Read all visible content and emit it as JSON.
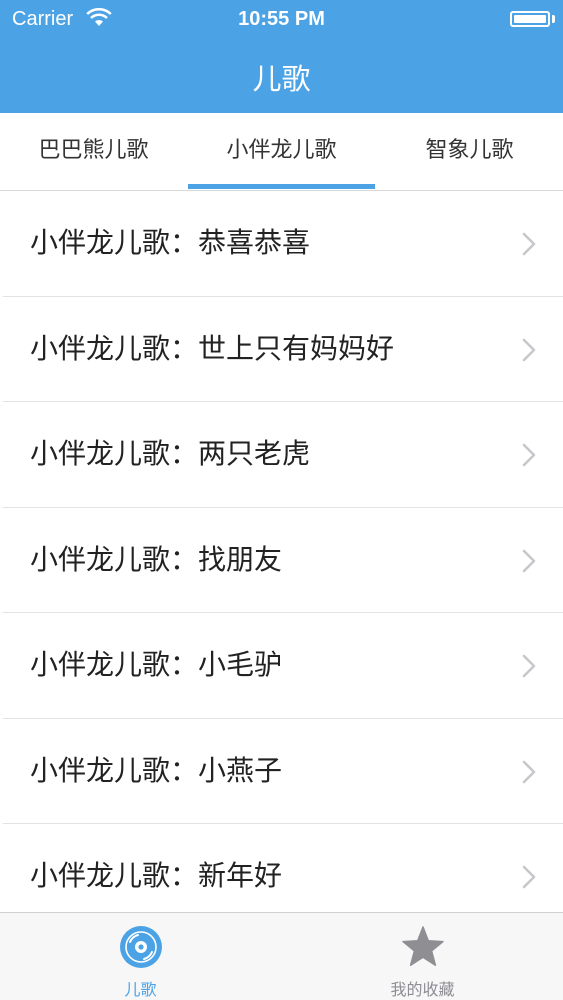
{
  "status_bar": {
    "carrier": "Carrier",
    "time": "10:55 PM",
    "wifi_icon": "wifi-icon",
    "battery_icon": "battery-icon"
  },
  "nav": {
    "title": "儿歌"
  },
  "tabs": [
    {
      "label": "巴巴熊儿歌",
      "selected": false
    },
    {
      "label": "小伴龙儿歌",
      "selected": true
    },
    {
      "label": "智象儿歌",
      "selected": false
    }
  ],
  "list": {
    "items": [
      {
        "label": "小伴龙儿歌：恭喜恭喜"
      },
      {
        "label": "小伴龙儿歌：世上只有妈妈好"
      },
      {
        "label": "小伴龙儿歌：两只老虎"
      },
      {
        "label": "小伴龙儿歌：找朋友"
      },
      {
        "label": "小伴龙儿歌：小毛驴"
      },
      {
        "label": "小伴龙儿歌：小燕子"
      },
      {
        "label": "小伴龙儿歌：新年好"
      }
    ],
    "chevron_icon": "chevron-right-icon"
  },
  "tabbar": {
    "items": [
      {
        "label": "儿歌",
        "icon": "disc-icon",
        "active": true
      },
      {
        "label": "我的收藏",
        "icon": "star-icon",
        "active": false
      }
    ]
  },
  "colors": {
    "accent": "#4ba3e6",
    "inactive": "#8e8e93",
    "separator": "#e3e3e3",
    "text": "#222222"
  }
}
